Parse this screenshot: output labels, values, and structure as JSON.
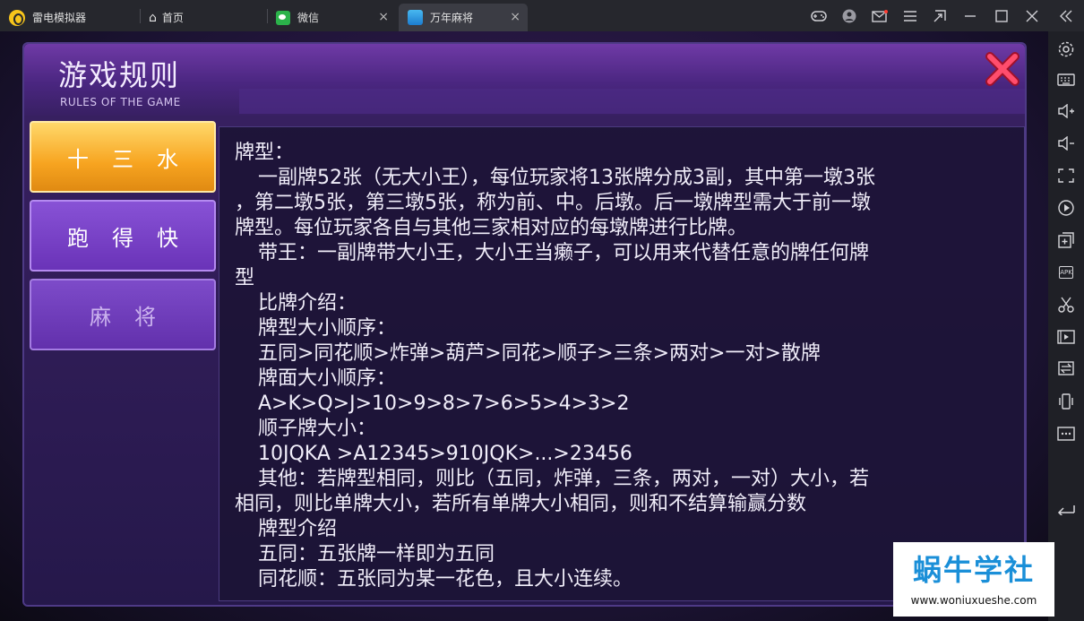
{
  "tabs": [
    {
      "label": "雷电模拟器",
      "icon": "leidian-logo-icon"
    },
    {
      "label": "首页",
      "icon": "home-icon"
    },
    {
      "label": "微信",
      "icon": "wechat-icon",
      "close": "×"
    },
    {
      "label": "万年麻将",
      "icon": "game-icon",
      "close": "×"
    }
  ],
  "window_controls": [
    "gamepad-icon",
    "account-icon",
    "mail-icon",
    "menu-icon",
    "shrink-icon",
    "minimize-icon",
    "maximize-icon",
    "close-icon",
    "collapse-icon"
  ],
  "sidebar": {
    "items": [
      "settings-icon",
      "keyboard-icon",
      "volume-up-icon",
      "volume-down-icon",
      "fullscreen-icon",
      "record-icon",
      "add-app-icon",
      "apk-icon",
      "scissors-icon",
      "video-icon",
      "sync-icon",
      "shake-icon",
      "more-icon",
      "back-icon"
    ],
    "apk_label": "APK"
  },
  "panel": {
    "title": "游戏规则",
    "subtitle": "RULES OF THE GAME",
    "close_icon": "close-x-icon",
    "menu": [
      {
        "label": "十三水",
        "state": "active"
      },
      {
        "label": "跑得快",
        "state": "normal"
      },
      {
        "label": "麻将",
        "state": "dim"
      }
    ],
    "content": [
      "牌型：",
      "一副牌52张（无大小王），每位玩家将13张牌分成3副，其中第一墩3张",
      "，第二墩5张，第三墩5张，称为前、中。后墩。后一墩牌型需大于前一墩",
      "牌型。每位玩家各自与其他三家相对应的每墩牌进行比牌。",
      "带王：一副牌带大小王，大小王当癞子，可以用来代替任意的牌任何牌",
      "型",
      "比牌介绍：",
      "牌型大小顺序：",
      "五同>同花顺>炸弹>葫芦>同花>顺子>三条>两对>一对>散牌",
      "牌面大小顺序：",
      "A>K>Q>J>10>9>8>7>6>5>4>3>2",
      "顺子牌大小：",
      "10JQKA >A12345>910JQK>...>23456",
      "其他：若牌型相同，则比（五同，炸弹，三条，两对，一对）大小，若",
      "相同，则比单牌大小，若所有单牌大小相同，则和不结算输赢分数",
      "牌型介绍",
      "五同：五张牌一样即为五同",
      "同花顺：五张同为某一花色，且大小连续。"
    ]
  },
  "watermark": {
    "title": "蜗牛学社",
    "url": "www.woniuxueshe.com"
  }
}
